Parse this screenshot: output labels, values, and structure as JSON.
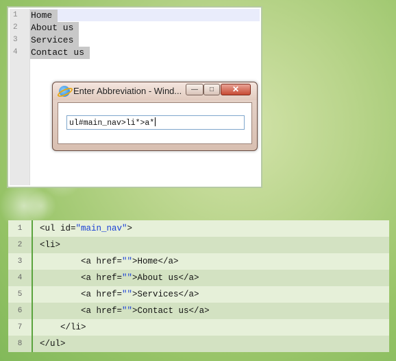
{
  "editor": {
    "line_numbers": [
      "1",
      "2",
      "3",
      "4"
    ],
    "lines": [
      "Home",
      "About us",
      "Services",
      "Contact us"
    ]
  },
  "dialog": {
    "title": "Enter Abbreviation - Wind...",
    "minimize_glyph": "—",
    "maximize_glyph": "□",
    "close_glyph": "✕",
    "input_value": "ul#main_nav>li*>a*"
  },
  "code": {
    "line_numbers": [
      "1",
      "2",
      "3",
      "4",
      "5",
      "6",
      "7",
      "8"
    ],
    "lines": [
      {
        "pre": "<ul id=",
        "str": "\"main_nav\"",
        "post": ">"
      },
      {
        "pre": "<li>",
        "str": "",
        "post": ""
      },
      {
        "pre": "        <a href=",
        "str": "\"\"",
        "post": ">Home</a>"
      },
      {
        "pre": "        <a href=",
        "str": "\"\"",
        "post": ">About us</a>"
      },
      {
        "pre": "        <a href=",
        "str": "\"\"",
        "post": ">Services</a>"
      },
      {
        "pre": "        <a href=",
        "str": "\"\"",
        "post": ">Contact us</a>"
      },
      {
        "pre": "    </li>",
        "str": "",
        "post": ""
      },
      {
        "pre": "</ul>",
        "str": "",
        "post": ""
      }
    ]
  }
}
